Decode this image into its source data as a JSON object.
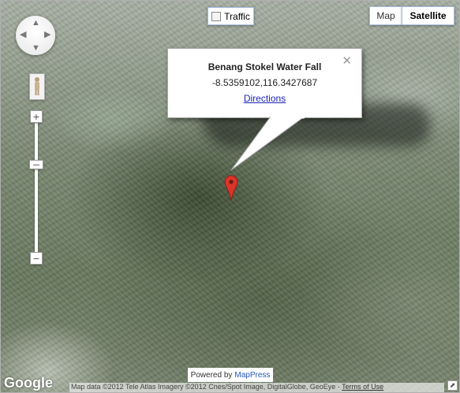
{
  "controls": {
    "traffic_label": "Traffic",
    "map_type_map": "Map",
    "map_type_satellite": "Satellite",
    "selected_map_type": "Satellite"
  },
  "icons": {
    "pan": "pan-control-icon",
    "pegman": "pegman-icon",
    "zoom_in": "plus-icon",
    "zoom_out": "minus-icon",
    "marker": "map-marker-icon",
    "close": "close-icon"
  },
  "infowindow": {
    "title": "Benang Stokel Water Fall",
    "coordinates": "-8.5359102,116.3427687",
    "link": "Directions"
  },
  "footer": {
    "google_logo": "Google",
    "powered_by": "Powered by",
    "powered_by_link": "MapPress",
    "attribution": "Map data ©2012 Tele Atlas Imagery ©2012 Cnes/Spot Image, DigitalGlobe, GeoEye -",
    "terms": "Terms of Use"
  },
  "colors": {
    "marker": "#d9352a",
    "link": "#1a24b5"
  }
}
